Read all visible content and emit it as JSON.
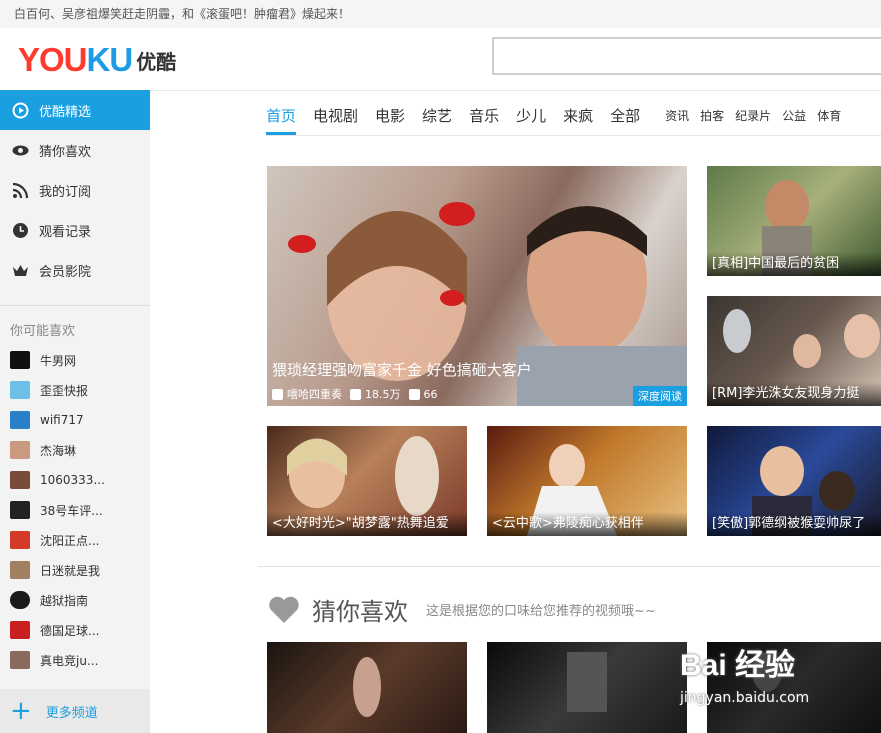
{
  "ticker": "白百何、吴彦祖爆笑赶走阴霾，和《滚蛋吧！肿瘤君》燥起来！",
  "logo": {
    "en_y": "YOU",
    "en_k": "KU",
    "cn": "优酷"
  },
  "search": {
    "value": "",
    "placeholder": ""
  },
  "sidebar": {
    "items": [
      {
        "label": "优酷精选",
        "icon": "play-circle-icon"
      },
      {
        "label": "猜你喜欢",
        "icon": "eye-icon"
      },
      {
        "label": "我的订阅",
        "icon": "rss-icon"
      },
      {
        "label": "观看记录",
        "icon": "clock-icon"
      },
      {
        "label": "会员影院",
        "icon": "crown-icon"
      }
    ],
    "maybe_like": "你可能喜欢",
    "channels": [
      "牛男网",
      "歪歪快报",
      "wifi717",
      "杰海琳",
      "1060333...",
      "38号车评...",
      "沈阳正点...",
      "日迷就是我",
      "越狱指南",
      "德国足球...",
      "真电竞ju..."
    ],
    "more": "更多频道"
  },
  "nav": {
    "tabs": [
      "首页",
      "电视剧",
      "电影",
      "综艺",
      "音乐",
      "少儿",
      "来疯",
      "全部"
    ],
    "small": [
      "资讯",
      "拍客",
      "纪录片",
      "公益",
      "体育"
    ]
  },
  "hero": {
    "title": "猥琐经理强吻富家千金 好色搞砸大客户",
    "uploader": "嘻哈四重奏",
    "plays": "18.5万",
    "comments": "66",
    "badge": "深度阅读"
  },
  "cards": [
    {
      "caption": "[真相]中国最后的贫困"
    },
    {
      "caption": "[RM]李光洙女友现身力挺"
    },
    {
      "caption": "<大好时光>\"胡梦露\"热舞追爱"
    },
    {
      "caption": "<云中歌>弗陵痴心获相伴"
    },
    {
      "caption": "[笑傲]郭德纲被猴耍帅尿了"
    }
  ],
  "section": {
    "title": "猜你喜欢",
    "subtitle": "这是根据您的口味给您推荐的视频哦~~"
  },
  "watermark": {
    "brand": "Bai 经验",
    "url": "jingyan.baidu.com"
  },
  "colors": {
    "accent": "#1a9fe0"
  }
}
